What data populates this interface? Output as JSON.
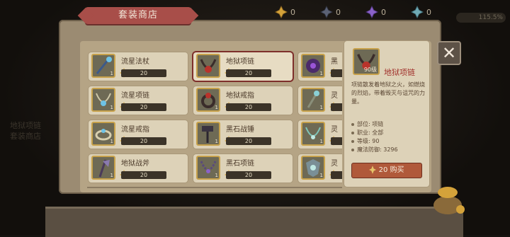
{
  "title": "套装商店",
  "currencies": [
    {
      "icon": "gold-cross-icon",
      "value": "0",
      "color": "#d4a23a"
    },
    {
      "icon": "dark-cross-icon",
      "value": "0",
      "color": "#5b6275"
    },
    {
      "icon": "purple-cross-icon",
      "value": "0",
      "color": "#8a62c9"
    },
    {
      "icon": "cyan-cross-icon",
      "value": "0",
      "color": "#6fa9b4"
    }
  ],
  "top_right_badge": "115.5%",
  "items": [
    {
      "name": "流星法杖",
      "price": "20",
      "level": "1"
    },
    {
      "name": "地狱项链",
      "price": "20",
      "level": "",
      "selected": true
    },
    {
      "name": "黑",
      "price": "20",
      "level": "1"
    },
    {
      "name": "流星项链",
      "price": "20",
      "level": "1"
    },
    {
      "name": "地狱戒指",
      "price": "20",
      "level": "1"
    },
    {
      "name": "灵",
      "price": "20",
      "level": "1"
    },
    {
      "name": "流星戒指",
      "price": "20",
      "level": "1"
    },
    {
      "name": "黑石战锤",
      "price": "20",
      "level": "1"
    },
    {
      "name": "灵",
      "price": "20",
      "level": "1"
    },
    {
      "name": "地狱战斧",
      "price": "20",
      "level": "1"
    },
    {
      "name": "黑石项链",
      "price": "20",
      "level": "1"
    },
    {
      "name": "灵",
      "price": "20",
      "level": "1"
    }
  ],
  "detail": {
    "name": "地狱项链",
    "level": "90级",
    "description": "项链散发着地狱之火，如燃烧的烈焰，带着毁灭与诅咒的力量。",
    "stats": [
      {
        "label": "部位: 项链"
      },
      {
        "label": "职业: 全部"
      },
      {
        "label": "等级: 90"
      },
      {
        "label": "魔法防御: 3296"
      }
    ],
    "buy_price": "20",
    "buy_label": "购买"
  },
  "close_label": "✕",
  "bg_lines": [
    "地狱项链",
    "套装商店"
  ]
}
